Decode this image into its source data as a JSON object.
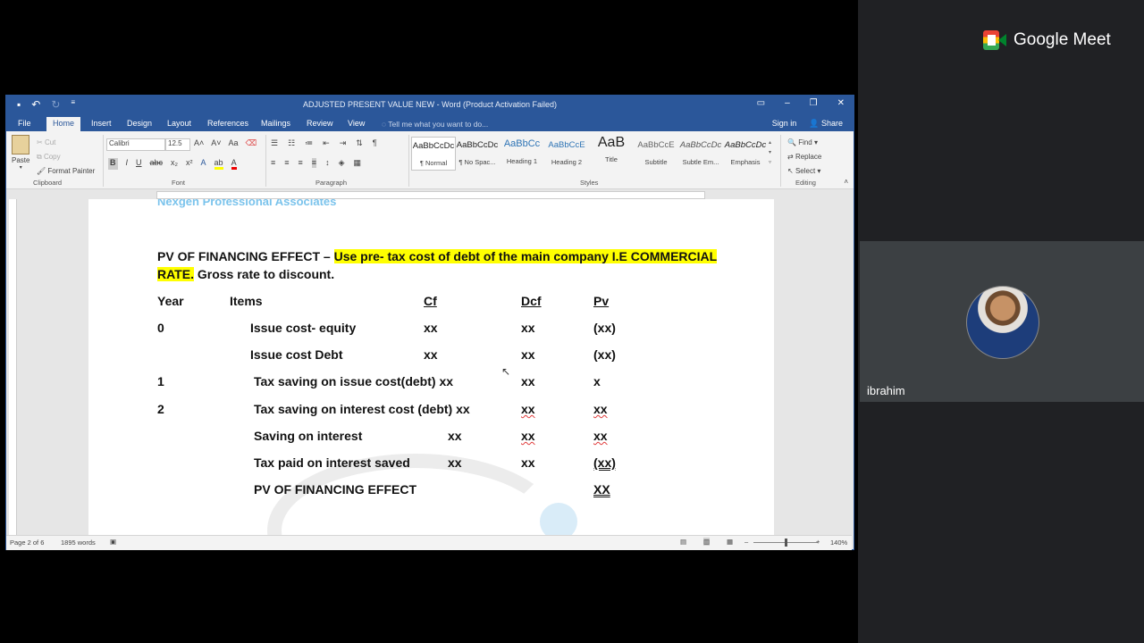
{
  "meet": {
    "brand": "Google Meet",
    "participant_name": "ibrahim"
  },
  "word": {
    "title": "ADJUSTED PRESENT VALUE NEW - Word (Product Activation Failed)",
    "tabs": [
      "File",
      "Home",
      "Insert",
      "Design",
      "Layout",
      "References",
      "Mailings",
      "Review",
      "View"
    ],
    "active_tab": "Home",
    "tell_me": "Tell me what you want to do...",
    "sign_in": "Sign in",
    "share": "Share",
    "clipboard": {
      "paste": "Paste",
      "cut": "Cut",
      "copy": "Copy",
      "format_painter": "Format Painter",
      "label": "Clipboard"
    },
    "font": {
      "name": "Calibri",
      "size": "12.5",
      "label": "Font"
    },
    "paragraph_label": "Paragraph",
    "styles": [
      {
        "preview": "AaBbCcDc",
        "name": "¶ Normal"
      },
      {
        "preview": "AaBbCcDc",
        "name": "¶ No Spac..."
      },
      {
        "preview": "AaBbCc",
        "name": "Heading 1"
      },
      {
        "preview": "AaBbCcE",
        "name": "Heading 2"
      },
      {
        "preview": "AaB",
        "name": "Title"
      },
      {
        "preview": "AaBbCcE",
        "name": "Subtitle"
      },
      {
        "preview": "AaBbCcDc",
        "name": "Subtle Em..."
      },
      {
        "preview": "AaBbCcDc",
        "name": "Emphasis"
      }
    ],
    "styles_label": "Styles",
    "editing": {
      "find": "Find",
      "replace": "Replace",
      "select": "Select",
      "label": "Editing"
    },
    "status": {
      "page": "Page 2 of 6",
      "words": "1895 words",
      "zoom": "140%"
    }
  },
  "document": {
    "header": "Nexgen Professional Associates",
    "heading_line1_plain": "PV OF FINANCING EFFECT – ",
    "heading_line1_highlight": "Use pre- tax cost of debt of the main company I.E COMMERCIAL",
    "heading_line2_highlight": "RATE.",
    "heading_line2_plain": " Gross rate to discount.",
    "columns": {
      "year": "Year",
      "items": "Items",
      "cf": "Cf",
      "dcf": "Dcf",
      "pv": "Pv"
    },
    "rows": [
      {
        "year": "0",
        "item": "Issue cost- equity",
        "cf": "xx",
        "dcf": "xx",
        "pv": "(xx)"
      },
      {
        "year": "",
        "item": "Issue cost Debt",
        "cf": "xx",
        "dcf": "xx",
        "pv": "(xx)"
      },
      {
        "year": "1",
        "item": "Tax saving on issue cost(debt) xx",
        "cf": "",
        "dcf": "xx",
        "pv": "x"
      },
      {
        "year": "2",
        "item": "Tax saving on interest cost (debt) xx",
        "cf": "",
        "dcf": "xx",
        "pv": "xx"
      },
      {
        "year": "",
        "item": "Saving on interest",
        "cf": "xx",
        "dcf": "xx",
        "pv": "xx"
      },
      {
        "year": "",
        "item": "Tax paid on interest saved",
        "cf": "xx",
        "dcf": "xx",
        "pv": "(xx)"
      },
      {
        "year": "",
        "item": "PV OF FINANCING EFFECT",
        "cf": "",
        "dcf": "",
        "pv": "XX"
      }
    ]
  }
}
